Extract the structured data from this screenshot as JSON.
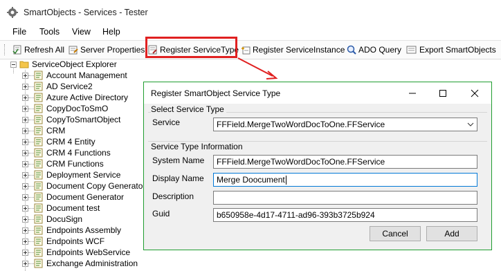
{
  "window": {
    "title": "SmartObjects - Services - Tester",
    "icon": "gear-icon"
  },
  "menu": [
    "File",
    "Tools",
    "View",
    "Help"
  ],
  "toolbar": {
    "refresh_all": "Refresh All",
    "server_properties": "Server Properties",
    "register_service_type": "Register ServiceType",
    "register_service_instance": "Register ServiceInstance",
    "ado_query": "ADO Query",
    "export_smartobjects": "Export SmartObjects"
  },
  "tree": {
    "root": "ServiceObject Explorer",
    "items": [
      "Account Management",
      "AD Service2",
      "Azure Active Directory",
      "CopyDocToSmO",
      "CopyToSmartObject",
      "CRM",
      "CRM 4 Entity",
      "CRM 4 Functions",
      "CRM Functions",
      "Deployment Service",
      "Document Copy Generator",
      "Document Generator",
      "Document test",
      "DocuSign",
      "Endpoints Assembly",
      "Endpoints WCF",
      "Endpoints WebService",
      "Exchange Administration"
    ]
  },
  "dialog": {
    "title": "Register SmartObject Service Type",
    "section_service_type": "Select Service Type",
    "service_label": "Service",
    "service_value": "FFField.MergeTwoWordDocToOne.FFService",
    "section_info": "Service Type Information",
    "system_name_label": "System Name",
    "system_name_value": "FFField.MergeTwoWordDocToOne.FFService",
    "display_name_label": "Display Name",
    "display_name_value": "Merge Doocument",
    "description_label": "Description",
    "description_value": "",
    "guid_label": "Guid",
    "guid_value": "b650958e-4d17-4711-ad96-393b3725b924",
    "cancel_label": "Cancel",
    "add_label": "Add"
  },
  "colors": {
    "highlight": "#e02020",
    "dialog_border": "#1f9d2f",
    "focus": "#0078d7"
  }
}
